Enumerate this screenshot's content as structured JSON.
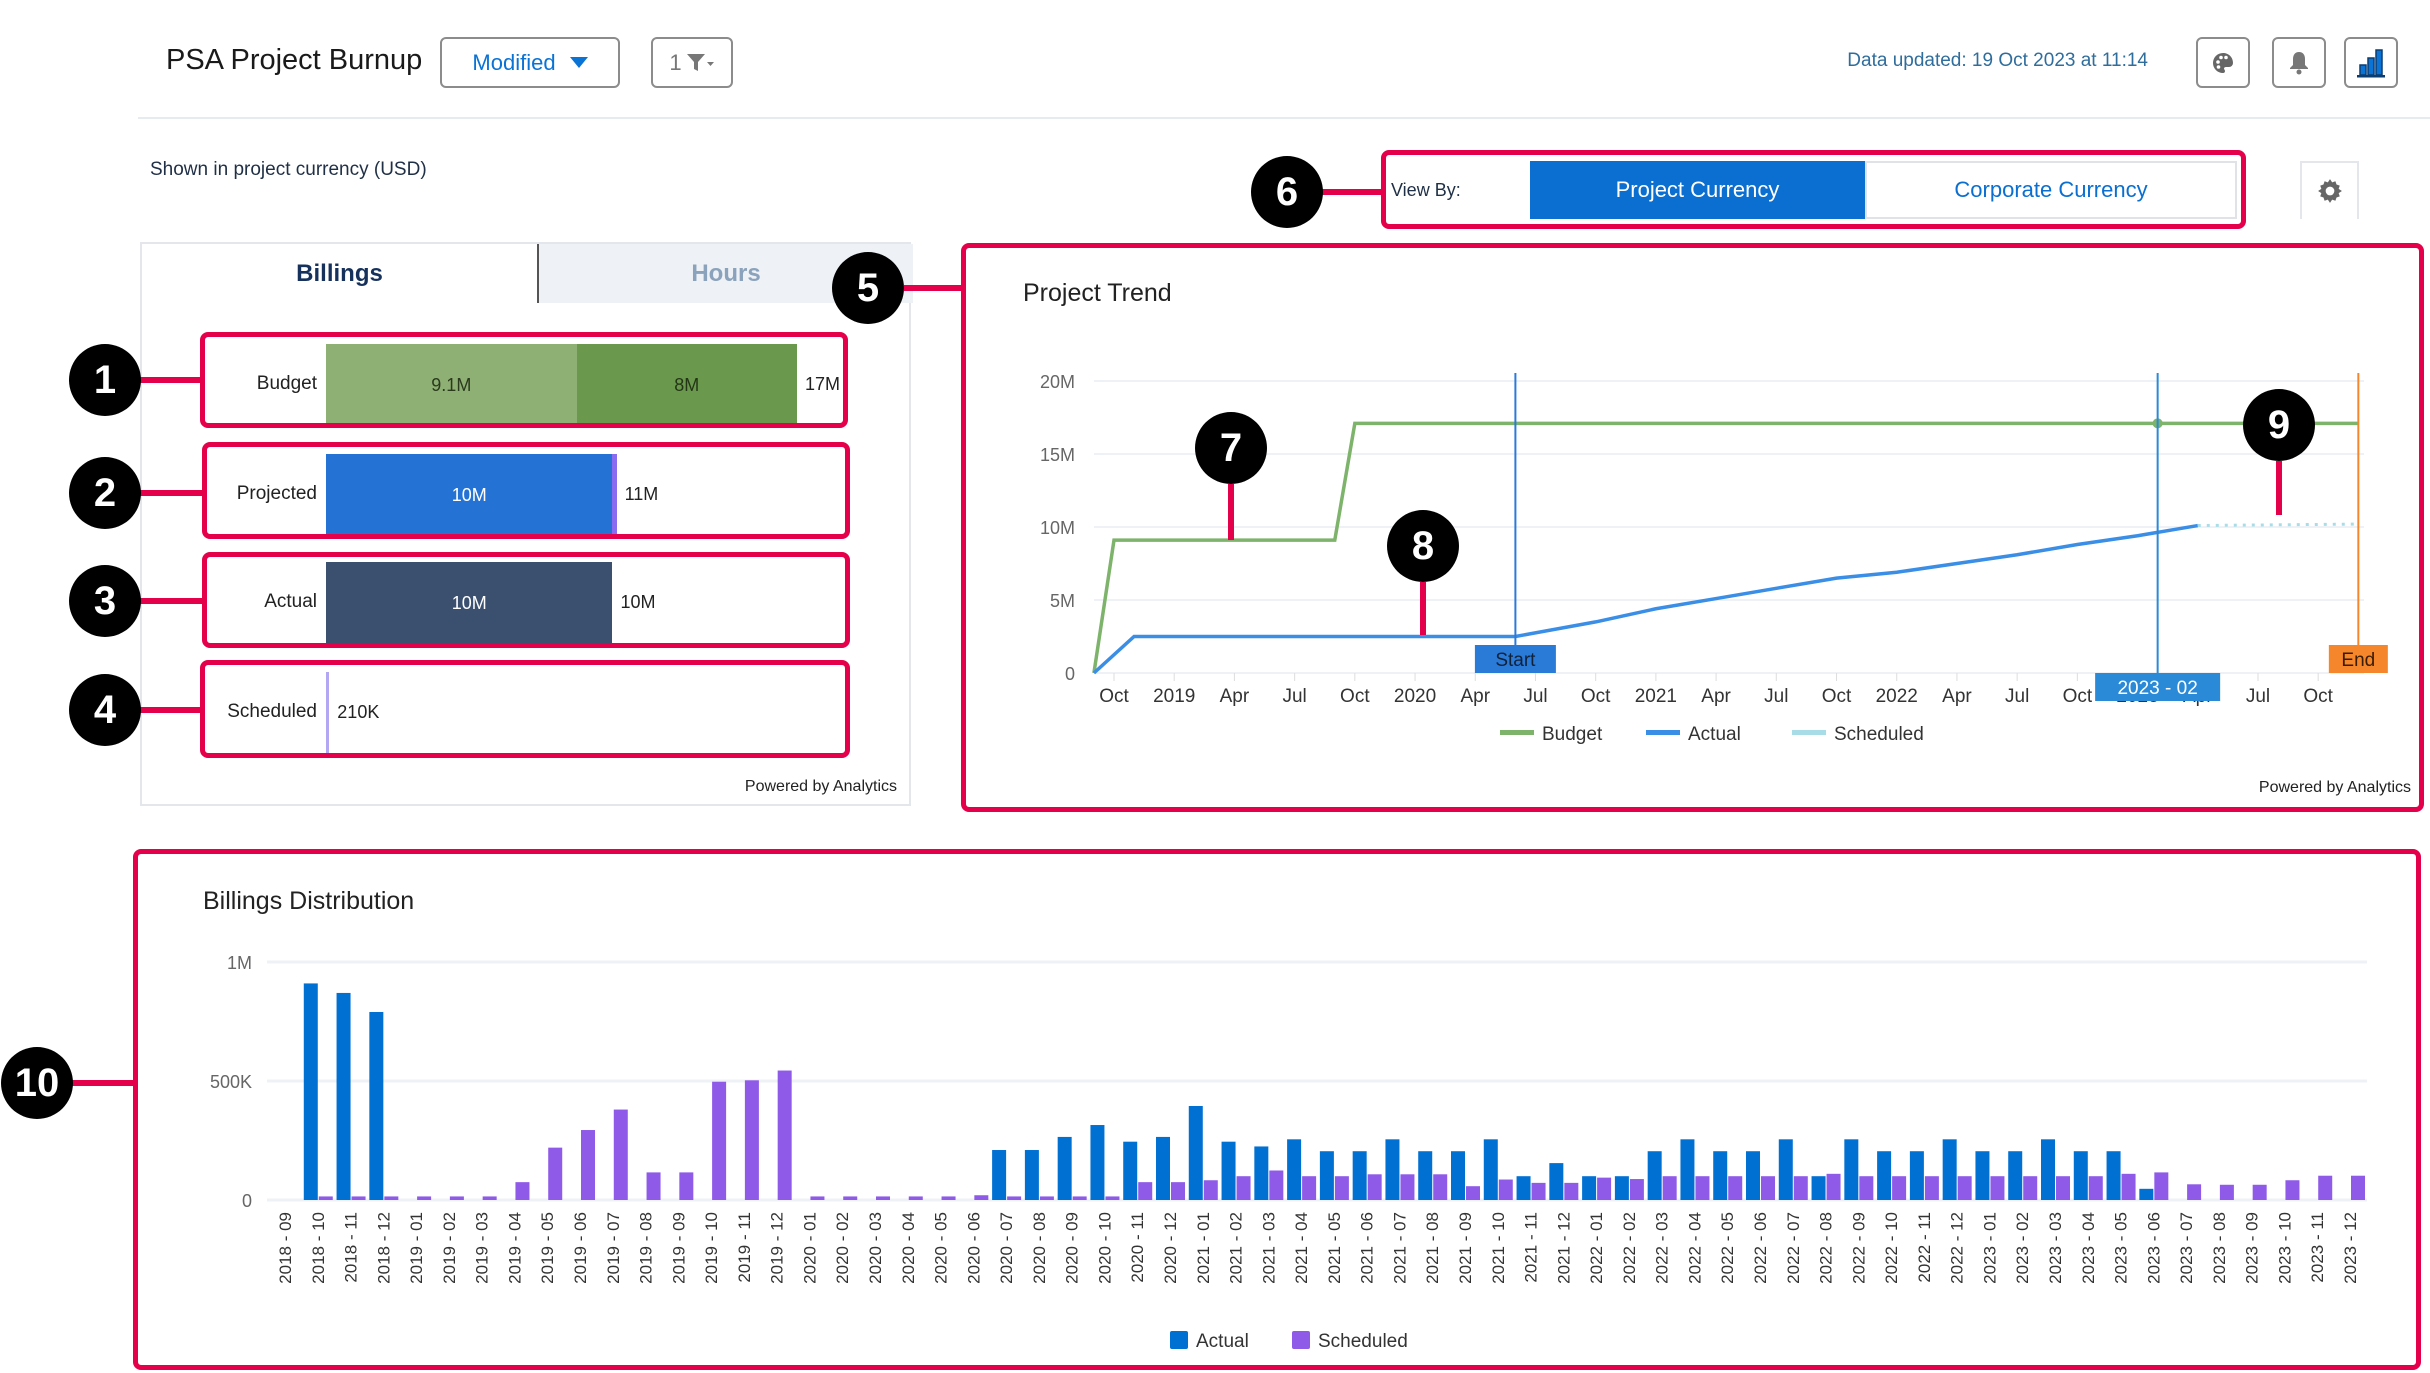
{
  "header": {
    "title": "PSA Project Burnup",
    "view_button": "Modified",
    "filter_count": "1",
    "data_updated": "Data updated: 19 Oct 2023 at 11:14",
    "icons": [
      "palette-icon",
      "bell-icon",
      "bar-chart-icon"
    ]
  },
  "currency_note": "Shown in project currency (USD)",
  "view_by": {
    "label": "View By:",
    "options": [
      {
        "label": "Project Currency",
        "active": true
      },
      {
        "label": "Corporate Currency",
        "active": false
      }
    ]
  },
  "summary": {
    "tabs": [
      {
        "label": "Billings",
        "active": true
      },
      {
        "label": "Hours",
        "active": false
      }
    ],
    "scale_max": 17.1,
    "rows": [
      {
        "label": "Budget",
        "segments": [
          {
            "value": 9.1,
            "label": "9.1M",
            "color": "#8fb075",
            "text": "#2a3a1c"
          },
          {
            "value": 8.0,
            "label": "8M",
            "color": "#6a994e",
            "text": "#243516"
          }
        ],
        "total_label": "17M"
      },
      {
        "label": "Projected",
        "segments": [
          {
            "value": 10.4,
            "label": "10M",
            "color": "#2472d4",
            "text": "#ffffff"
          },
          {
            "value": 0.15,
            "label": "",
            "color": "#8a6cf0",
            "text": "#ffffff"
          }
        ],
        "total_label": "11M"
      },
      {
        "label": "Actual",
        "segments": [
          {
            "value": 10.4,
            "label": "10M",
            "color": "#3b4f6e",
            "text": "#ffffff"
          }
        ],
        "total_label": "10M"
      },
      {
        "label": "Scheduled",
        "segments": [
          {
            "value": 0.12,
            "label": "",
            "color": "#b3a6f2",
            "text": "#ffffff"
          }
        ],
        "total_label": "210K"
      }
    ],
    "powered": "Powered by Analytics"
  },
  "trend": {
    "title": "Project Trend",
    "powered": "Powered by Analytics",
    "chart_data": {
      "type": "line",
      "ylim": [
        0,
        20
      ],
      "yticks": [
        {
          "v": 0,
          "label": "0"
        },
        {
          "v": 5,
          "label": "5M"
        },
        {
          "v": 10,
          "label": "10M"
        },
        {
          "v": 15,
          "label": "15M"
        },
        {
          "v": 20,
          "label": "20M"
        }
      ],
      "xticks": [
        {
          "x": "2018-10",
          "label": "Oct"
        },
        {
          "x": "2019-01",
          "label": "2019"
        },
        {
          "x": "2019-04",
          "label": "Apr"
        },
        {
          "x": "2019-07",
          "label": "Jul"
        },
        {
          "x": "2019-10",
          "label": "Oct"
        },
        {
          "x": "2020-01",
          "label": "2020"
        },
        {
          "x": "2020-04",
          "label": "Apr"
        },
        {
          "x": "2020-07",
          "label": "Jul"
        },
        {
          "x": "2020-10",
          "label": "Oct"
        },
        {
          "x": "2021-01",
          "label": "2021"
        },
        {
          "x": "2021-04",
          "label": "Apr"
        },
        {
          "x": "2021-07",
          "label": "Jul"
        },
        {
          "x": "2021-10",
          "label": "Oct"
        },
        {
          "x": "2022-01",
          "label": "2022"
        },
        {
          "x": "2022-04",
          "label": "Apr"
        },
        {
          "x": "2022-07",
          "label": "Jul"
        },
        {
          "x": "2022-10",
          "label": "Oct"
        },
        {
          "x": "2023-01",
          "label": "2023"
        },
        {
          "x": "2023-04",
          "label": "Apr"
        },
        {
          "x": "2023-07",
          "label": "Jul"
        },
        {
          "x": "2023-10",
          "label": "Oct"
        }
      ],
      "series": [
        {
          "name": "Budget",
          "color": "#7db36a",
          "dashed": false,
          "points": [
            [
              "2018-09",
              0
            ],
            [
              "2018-10",
              9.1
            ],
            [
              "2019-09",
              9.1
            ],
            [
              "2019-10",
              17.1
            ],
            [
              "2023-12",
              17.1
            ]
          ]
        },
        {
          "name": "Actual",
          "color": "#3a8ee6",
          "dashed": false,
          "points": [
            [
              "2018-09",
              0
            ],
            [
              "2018-11",
              2.5
            ],
            [
              "2020-06",
              2.5
            ],
            [
              "2020-10",
              3.5
            ],
            [
              "2021-01",
              4.4
            ],
            [
              "2021-04",
              5.1
            ],
            [
              "2021-07",
              5.8
            ],
            [
              "2021-10",
              6.5
            ],
            [
              "2022-01",
              6.9
            ],
            [
              "2022-04",
              7.5
            ],
            [
              "2022-07",
              8.1
            ],
            [
              "2022-10",
              8.8
            ],
            [
              "2023-01",
              9.4
            ],
            [
              "2023-04",
              10.1
            ]
          ]
        },
        {
          "name": "Scheduled",
          "color": "#a8dde8",
          "dashed": true,
          "points": [
            [
              "2023-04",
              10.1
            ],
            [
              "2023-12",
              10.2
            ]
          ]
        }
      ],
      "markers": [
        {
          "x": "2020-06",
          "label": "Start",
          "color": "#2a7ad8",
          "text": "#10223a"
        },
        {
          "x": "2023-02",
          "label": "2023 - 02",
          "color": "#2a8ad8",
          "text": "#ffffff",
          "bottom": true
        },
        {
          "x": "2023-12",
          "label": "End",
          "color": "#f5862b",
          "text": "#3a1c00"
        }
      ],
      "budget_dot": [
        "2023-02",
        17.1
      ],
      "legend": "bottom"
    }
  },
  "distribution": {
    "title": "Billings Distribution",
    "chart_data": {
      "type": "bar",
      "ylim": [
        0,
        1000000
      ],
      "yticks": [
        {
          "v": 0,
          "label": "0"
        },
        {
          "v": 500000,
          "label": "500K"
        },
        {
          "v": 1000000,
          "label": "1M"
        }
      ],
      "categories": [
        "2018 - 09",
        "2018 - 10",
        "2018 - 11",
        "2018 - 12",
        "2019 - 01",
        "2019 - 02",
        "2019 - 03",
        "2019 - 04",
        "2019 - 05",
        "2019 - 06",
        "2019 - 07",
        "2019 - 08",
        "2019 - 09",
        "2019 - 10",
        "2019 - 11",
        "2019 - 12",
        "2020 - 01",
        "2020 - 02",
        "2020 - 03",
        "2020 - 04",
        "2020 - 05",
        "2020 - 06",
        "2020 - 07",
        "2020 - 08",
        "2020 - 09",
        "2020 - 10",
        "2020 - 11",
        "2020 - 12",
        "2021 - 01",
        "2021 - 02",
        "2021 - 03",
        "2021 - 04",
        "2021 - 05",
        "2021 - 06",
        "2021 - 07",
        "2021 - 08",
        "2021 - 09",
        "2021 - 10",
        "2021 - 11",
        "2021 - 12",
        "2022 - 01",
        "2022 - 02",
        "2022 - 03",
        "2022 - 04",
        "2022 - 05",
        "2022 - 06",
        "2022 - 07",
        "2022 - 08",
        "2022 - 09",
        "2022 - 10",
        "2022 - 11",
        "2022 - 12",
        "2023 - 01",
        "2023 - 02",
        "2023 - 03",
        "2023 - 04",
        "2023 - 05",
        "2023 - 06",
        "2023 - 07",
        "2023 - 08",
        "2023 - 09",
        "2023 - 10",
        "2023 - 11",
        "2023 - 12"
      ],
      "series": [
        {
          "name": "Actual",
          "color": "#0070d2",
          "values": [
            0,
            910000,
            870000,
            790000,
            0,
            0,
            0,
            0,
            0,
            0,
            0,
            0,
            0,
            0,
            0,
            0,
            0,
            0,
            0,
            0,
            0,
            0,
            210000,
            210000,
            265000,
            315000,
            245000,
            265000,
            395000,
            245000,
            225000,
            255000,
            205000,
            205000,
            255000,
            205000,
            205000,
            255000,
            100000,
            155000,
            100000,
            100000,
            205000,
            255000,
            205000,
            205000,
            255000,
            100000,
            255000,
            205000,
            205000,
            255000,
            205000,
            205000,
            255000,
            205000,
            205000,
            47000,
            0,
            0,
            0,
            0,
            0,
            0
          ]
        },
        {
          "name": "Scheduled",
          "color": "#8f5ae8",
          "values": [
            0,
            15000,
            15000,
            15000,
            15000,
            15000,
            15000,
            75000,
            220000,
            294000,
            380000,
            116000,
            116000,
            497000,
            503000,
            544000,
            15000,
            15000,
            15000,
            15000,
            15000,
            20000,
            15000,
            15000,
            15000,
            15000,
            75000,
            75000,
            83000,
            100000,
            124000,
            100000,
            100000,
            108000,
            108000,
            108000,
            58000,
            86000,
            72000,
            72000,
            94000,
            88000,
            100000,
            100000,
            100000,
            100000,
            100000,
            110000,
            100000,
            100000,
            100000,
            100000,
            100000,
            100000,
            100000,
            100000,
            110000,
            116000,
            66000,
            64000,
            64000,
            83000,
            102000,
            102000
          ]
        }
      ],
      "legend": "bottom"
    }
  },
  "annotations": [
    "1",
    "2",
    "3",
    "4",
    "5",
    "6",
    "7",
    "8",
    "9",
    "10"
  ]
}
